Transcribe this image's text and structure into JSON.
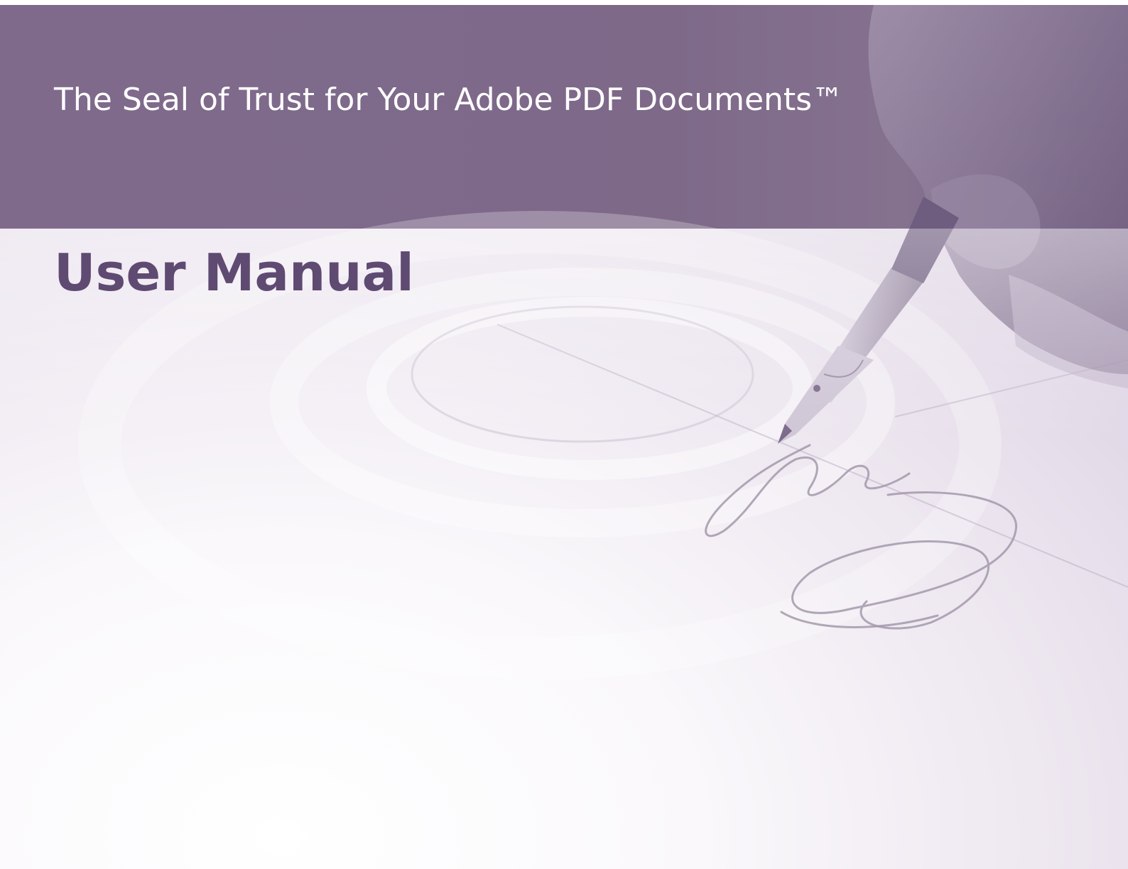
{
  "cover": {
    "tagline": "The Seal of Trust for Your Adobe PDF Documents™",
    "title": "User Manual"
  },
  "colors": {
    "header_band": "#7f6a8c",
    "title_text": "#5f4a72",
    "tagline_text": "#ffffff",
    "background": "#f6f3f7"
  },
  "illustration": {
    "subject": "hand-holding-fountain-pen-signing",
    "icon": "fountain-pen-icon"
  }
}
